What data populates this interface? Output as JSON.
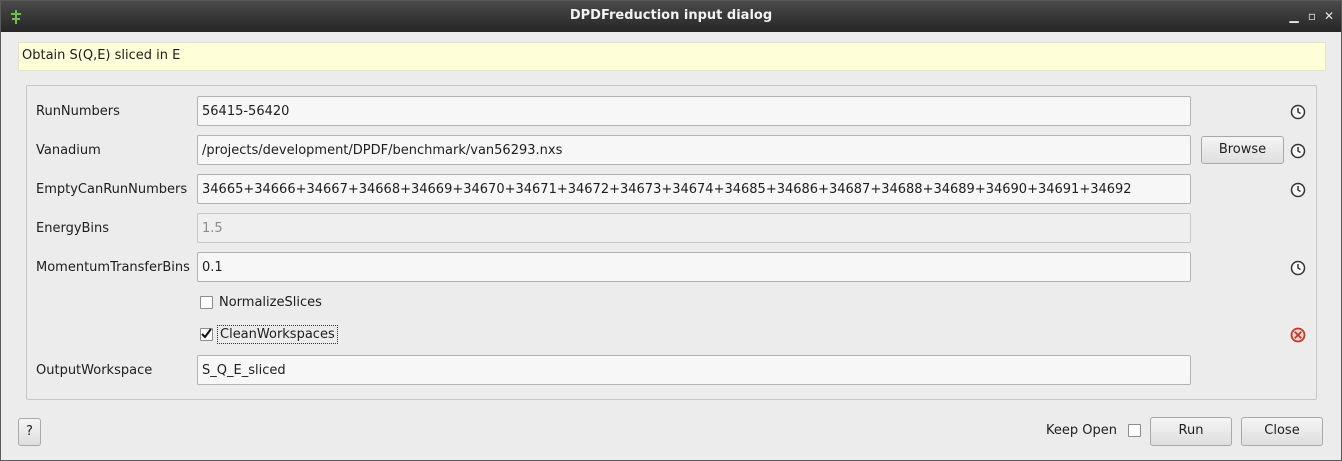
{
  "window": {
    "title": "DPDFreduction input dialog"
  },
  "description": "Obtain S(Q,E) sliced in E",
  "properties": {
    "run_numbers": {
      "label": "RunNumbers",
      "value": "56415-56420"
    },
    "vanadium": {
      "label": "Vanadium",
      "value": "/projects/development/DPDF/benchmark/van56293.nxs",
      "browse_label": "Browse"
    },
    "empty_can": {
      "label": "EmptyCanRunNumbers",
      "value": "34665+34666+34667+34668+34669+34670+34671+34672+34673+34674+34685+34686+34687+34688+34689+34690+34691+34692"
    },
    "energy_bins": {
      "label": "EnergyBins",
      "value": "1.5"
    },
    "momentum_bins": {
      "label": "MomentumTransferBins",
      "value": "0.1"
    },
    "normalize_slices": {
      "label": "NormalizeSlices",
      "checked": false
    },
    "clean_workspaces": {
      "label": "CleanWorkspaces",
      "checked": true
    },
    "output_workspace": {
      "label": "OutputWorkspace",
      "value": "S_Q_E_sliced"
    }
  },
  "footer": {
    "help_label": "?",
    "keep_open_label": "Keep Open",
    "keep_open_checked": false,
    "run_label": "Run",
    "close_label": "Close"
  },
  "icons": {
    "history": "clock-icon",
    "invalid": "error-circle-icon"
  },
  "colors": {
    "description_bg": "#fefed9",
    "error_red": "#c0392b"
  }
}
